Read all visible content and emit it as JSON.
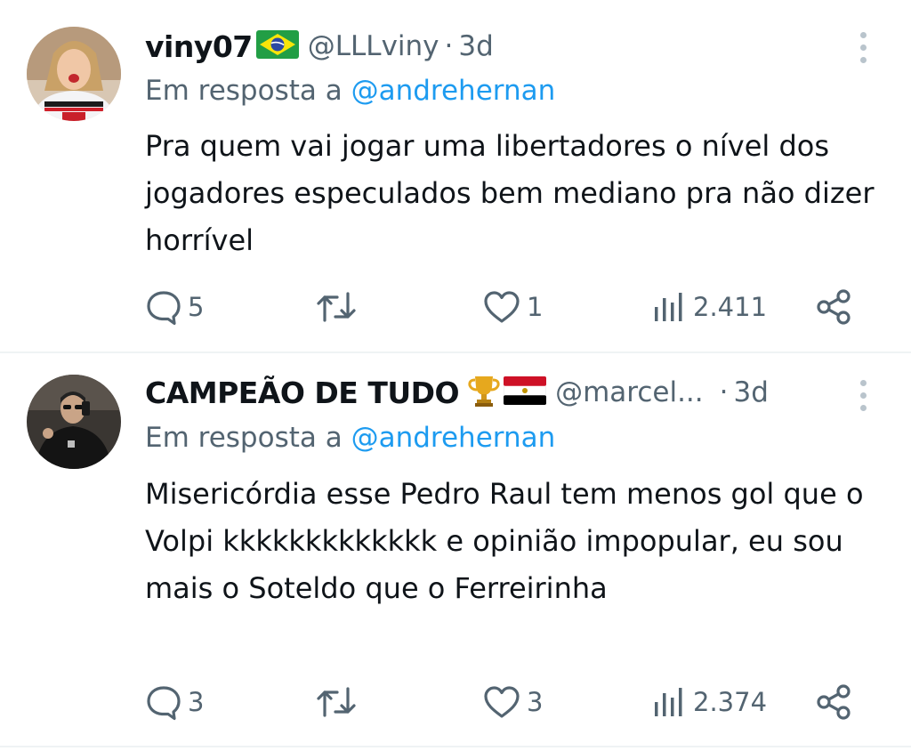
{
  "tweets": [
    {
      "name": "viny07",
      "flag": "brazil-flag",
      "handle": "@LLLviny",
      "separator": "·",
      "time": "3d",
      "reply_prefix": "Em resposta a",
      "reply_to": "@andrehernan",
      "text": "Pra quem vai jogar uma libertadores o nível dos jogadores especulados bem mediano pra não dizer horrível",
      "replies": "5",
      "retweets": "",
      "likes": "1",
      "views": "2.411"
    },
    {
      "name": "CAMPEÃO DE TUDO",
      "flag": "trophy-and-egypt-flag",
      "handle": "@marcel...",
      "separator": "·",
      "time": "3d",
      "reply_prefix": "Em resposta a",
      "reply_to": "@andrehernan",
      "text": "Misericórdia esse Pedro Raul tem menos gol que o Volpi kkkkkkkkkkkkk e opinião impopular, eu sou mais o Soteldo que o Ferreirinha",
      "replies": "3",
      "retweets": "",
      "likes": "3",
      "views": "2.374"
    }
  ],
  "colors": {
    "text": "#0f1419",
    "secondary": "#536471",
    "link": "#1d9bf0",
    "divider": "#eff3f4"
  }
}
